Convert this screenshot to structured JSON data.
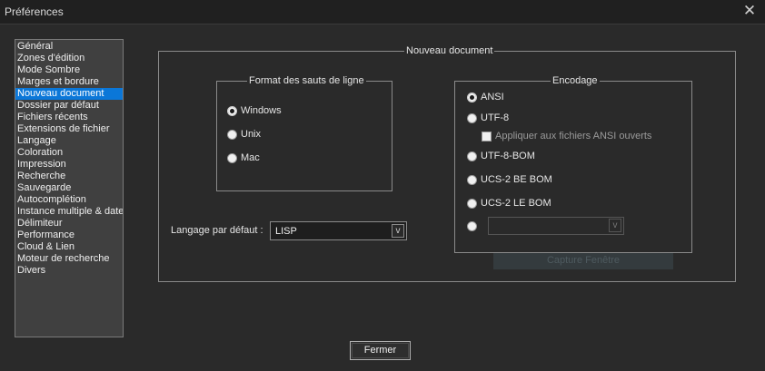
{
  "window": {
    "title": "Préférences",
    "close_icon": "close-icon"
  },
  "sidebar": {
    "selected_index": 4,
    "items": [
      "Général",
      "Zones d'édition",
      "Mode Sombre",
      "Marges et bordure",
      "Nouveau document",
      "Dossier par défaut",
      "Fichiers récents",
      "Extensions de fichier",
      "Langage",
      "Coloration",
      "Impression",
      "Recherche",
      "Sauvegarde",
      "Autocomplétion",
      "Instance multiple & date",
      "Délimiteur",
      "Performance",
      "Cloud & Lien",
      "Moteur de recherche",
      "Divers"
    ]
  },
  "main": {
    "group_title": "Nouveau document",
    "line_format": {
      "title": "Format des sauts de ligne",
      "options": [
        "Windows",
        "Unix",
        "Mac"
      ],
      "selected": "Windows"
    },
    "default_language": {
      "label": "Langage par défaut :",
      "value": "LISP",
      "dropdown_glyph": "v"
    },
    "encoding": {
      "title": "Encodage",
      "options": [
        "ANSI",
        "UTF-8",
        "UTF-8-BOM",
        "UCS-2 BE BOM",
        "UCS-2 LE BOM"
      ],
      "selected": "ANSI",
      "apply_ansi_label": "Appliquer aux fichiers ANSI ouverts",
      "apply_ansi_checked": false,
      "other_value": "",
      "other_dropdown_glyph": "v"
    },
    "capture_button": "Capture Fenêtre"
  },
  "footer": {
    "close_button": "Fermer"
  },
  "colors": {
    "selection": "#0b77d8",
    "background": "#2a2a2a",
    "titlebar": "#202020"
  }
}
